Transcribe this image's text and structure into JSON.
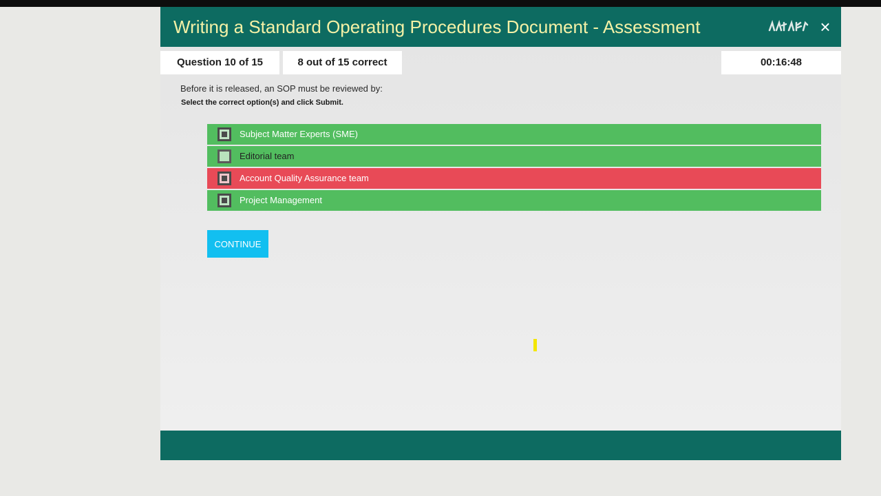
{
  "header": {
    "title": "Writing a Standard Operating Procedures Document - Assessment",
    "close_label": "×"
  },
  "status": {
    "question_progress": "Question 10 of 15",
    "score": "8 out of 15 correct",
    "timer": "00:16:48"
  },
  "question": {
    "text": "Before it is released, an SOP must be reviewed by:",
    "instruction": "Select the correct option(s) and click Submit."
  },
  "options": [
    {
      "label": "Subject Matter Experts (SME)",
      "checked": true,
      "result": "correct"
    },
    {
      "label": "Editorial team",
      "checked": false,
      "result": "correct"
    },
    {
      "label": "Account Quality Assurance team",
      "checked": true,
      "result": "incorrect"
    },
    {
      "label": "Project Management",
      "checked": true,
      "result": "correct"
    }
  ],
  "actions": {
    "continue_label": "CONTINUE"
  },
  "colors": {
    "header_bg": "#0d6b61",
    "title_text": "#f4f1a6",
    "correct_option": "#52bd5f",
    "incorrect_option": "#e84a57",
    "continue_button": "#12bff0"
  }
}
